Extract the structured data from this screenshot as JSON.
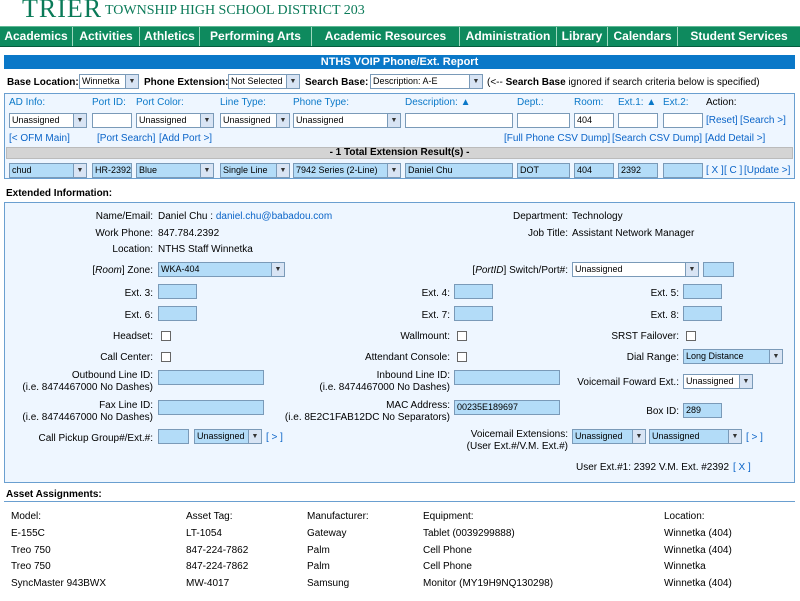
{
  "banner": {
    "logo": "TRIER",
    "district": "TOWNSHIP HIGH SCHOOL DISTRICT 203"
  },
  "nav": [
    "Academics",
    "Activities",
    "Athletics",
    "Performing Arts",
    "Academic Resources",
    "Administration",
    "Library",
    "Calendars",
    "Student Services"
  ],
  "report_title": "NTHS VOIP Phone/Ext. Report",
  "toolbar": {
    "base_location_label": "Base Location:",
    "base_location_value": "Winnetka",
    "phone_extension_label": "Phone Extension:",
    "phone_extension_value": "Not Selected",
    "search_base_label": "Search Base:",
    "search_base_value": "Description: A-E",
    "hint_prefix": "(<-- ",
    "hint_bold": "Search Base",
    "hint_suffix": " ignored if search criteria below is specified)"
  },
  "filter": {
    "headers": {
      "ad_info": "AD Info:",
      "port_id": "Port ID:",
      "port_color": "Port Color:",
      "line_type": "Line Type:",
      "phone_type": "Phone Type:",
      "description": "Description:",
      "sort_up": "▲",
      "dept": "Dept.:",
      "room": "Room:",
      "ext1": "Ext.1:",
      "ext1_sort": "▲",
      "ext2": "Ext.2:",
      "action": "Action:"
    },
    "row": {
      "ad_info": "Unassigned",
      "port_id": "",
      "port_color": "Unassigned",
      "line_type": "Unassigned",
      "phone_type": "Unassigned",
      "description": "",
      "dept": "",
      "room": "404",
      "ext1": "",
      "ext2": ""
    },
    "actions": {
      "reset": "[Reset]",
      "search": "[Search >]"
    },
    "links": {
      "ofm_main": "[< OFM Main]",
      "port_search": "[Port Search]",
      "add_port": "[Add Port >]",
      "csv_dump": "[Full Phone CSV Dump]",
      "search_csv": "[Search CSV Dump]",
      "add_detail": "[Add Detail >]"
    },
    "result_bar": "- 1 Total Extension Result(s) -",
    "result_row": {
      "ad_info": "chud",
      "port_id": "HR-2392-",
      "port_color": "Blue",
      "line_type": "Single Line",
      "phone_type": "7942 Series (2-Line)",
      "description": "Daniel Chu",
      "dept": "DOT",
      "room": "404",
      "ext1": "2392",
      "ext2": "",
      "x": "[ X ]",
      "c": "[ C ]",
      "update": "[Update >]"
    }
  },
  "extended": {
    "section_title": "Extended Information:",
    "name_email_label": "Name/Email:",
    "name": "Daniel Chu",
    "email_sep": " : ",
    "email": "daniel.chu@babadou.com",
    "work_phone_label": "Work Phone:",
    "work_phone": "847.784.2392",
    "location_label": "Location:",
    "location": "NTHS Staff Winnetka",
    "department_label": "Department:",
    "department": "Technology",
    "job_title_label": "Job Title:",
    "job_title": "Assistant Network Manager",
    "room_zone_label_pre": "[",
    "room_zone_label_it": "Room",
    "room_zone_label_post": "] Zone:",
    "room_zone": "WKA-404",
    "switch_label_pre": "[",
    "switch_label_it": "PortID",
    "switch_label_post": "] Switch/Port#:",
    "switch": "Unassigned",
    "switch_port": "",
    "ext3_label": "Ext. 3:",
    "ext4_label": "Ext. 4:",
    "ext5_label": "Ext. 5:",
    "ext6_label": "Ext. 6:",
    "ext7_label": "Ext. 7:",
    "ext8_label": "Ext. 8:",
    "headset_label": "Headset:",
    "wallmount_label": "Wallmount:",
    "srst_label": "SRST Failover:",
    "call_center_label": "Call Center:",
    "attendant_label": "Attendant Console:",
    "dial_range_label": "Dial Range:",
    "dial_range": "Long Distance",
    "outbound_label": "Outbound Line ID:",
    "outbound_hint": "(i.e. 8474467000 No Dashes)",
    "inbound_label": "Inbound Line ID:",
    "inbound_hint": "(i.e. 8474467000 No Dashes)",
    "vm_forward_label": "Voicemail Foward Ext.:",
    "vm_forward": "Unassigned",
    "fax_label": "Fax Line ID:",
    "fax_hint": "(i.e. 8474467000 No Dashes)",
    "mac_label": "MAC Address:",
    "mac_hint": "(i.e. 8E2C1FAB12DC No Separators)",
    "mac": "00235E189697",
    "box_id_label": "Box ID:",
    "box_id": "289",
    "pickup_label": "Call Pickup Group#/Ext.#:",
    "pickup_select": "Unassigned",
    "pickup_go": "[ > ]",
    "vm_ext_label": "Voicemail Extensions:",
    "vm_ext_hint": "(User Ext.#/V.M. Ext.#)",
    "vm_ext_a": "Unassigned",
    "vm_ext_b": "Unassigned",
    "vm_ext_go": "[ > ]",
    "user_ext_summary": "User Ext.#1: 2392  V.M. Ext. #2392",
    "user_ext_x": "[ X ]"
  },
  "assets": {
    "section_title": "Asset Assignments:",
    "headers": [
      "Model:",
      "Asset Tag:",
      "Manufacturer:",
      "Equipment:",
      "Location:"
    ],
    "rows": [
      [
        "E-155C",
        "LT-1054",
        "Gateway",
        "Tablet (0039299888)",
        "Winnetka (404)"
      ],
      [
        "Treo 750",
        "847-224-7862",
        "Palm",
        "Cell Phone",
        "Winnetka (404)"
      ],
      [
        "Treo 750",
        "847-224-7862",
        "Palm",
        "Cell Phone",
        "Winnetka"
      ],
      [
        "SyncMaster 943BWX",
        "MW-4017",
        "Samsung",
        "Monitor (MY19H9NQ130298)",
        "Winnetka (404)"
      ]
    ]
  }
}
